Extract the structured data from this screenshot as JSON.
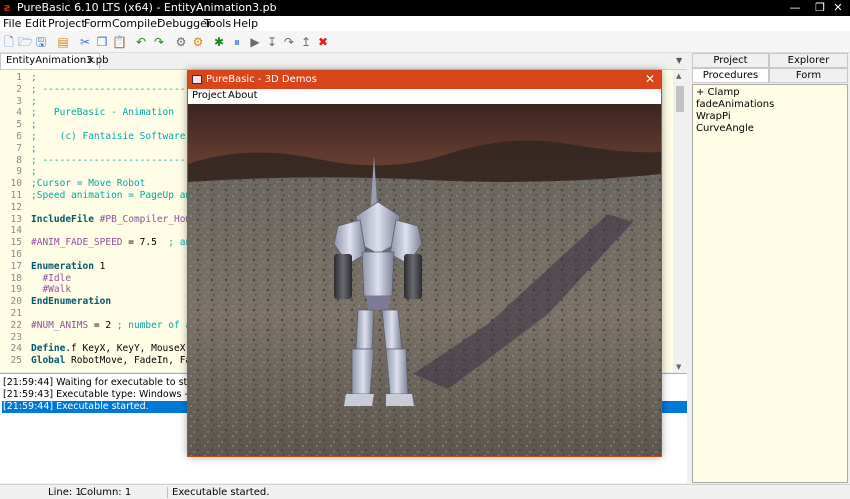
{
  "app": {
    "title": "PureBasic 6.10 LTS (x64) - EntityAnimation3.pb",
    "icon": "purebasic-logo-icon",
    "window_controls": [
      "minimize",
      "maximize",
      "close"
    ]
  },
  "menu": [
    "File",
    "Edit",
    "Project",
    "Form",
    "Compiler",
    "Debugger",
    "Tools",
    "Help"
  ],
  "toolbar": [
    {
      "icon": "new-file-icon",
      "glyph": "🗋",
      "color": "#3c78c8"
    },
    {
      "icon": "open-file-icon",
      "glyph": "🗁",
      "color": "#3c78c8"
    },
    {
      "icon": "save-icon",
      "glyph": "🖫",
      "color": "#3c78c8"
    },
    {
      "icon": "close-file-icon",
      "glyph": "▤",
      "color": "#d08a20"
    },
    {
      "icon": "cut-icon",
      "glyph": "✂",
      "color": "#3c78c8"
    },
    {
      "icon": "copy-icon",
      "glyph": "❐",
      "color": "#3c78c8"
    },
    {
      "icon": "paste-icon",
      "glyph": "📋",
      "color": "#d08a20"
    },
    {
      "icon": "undo-icon",
      "glyph": "↶",
      "color": "#1a8a1a"
    },
    {
      "icon": "redo-icon",
      "glyph": "↷",
      "color": "#1a8a1a"
    },
    {
      "icon": "compile-run-icon",
      "glyph": "⚙",
      "color": "#6a6a6a"
    },
    {
      "icon": "build-icon",
      "glyph": "⚙",
      "color": "#d08a20"
    },
    {
      "icon": "debugger-icon",
      "glyph": "✱",
      "color": "#1a8a1a"
    },
    {
      "icon": "pause-icon",
      "glyph": "⏸",
      "color": "#3c78c8"
    },
    {
      "icon": "continue-icon",
      "glyph": "▶",
      "color": "#6a6a6a"
    },
    {
      "icon": "step-icon",
      "glyph": "↧",
      "color": "#6a6a6a"
    },
    {
      "icon": "step-over-icon",
      "glyph": "↷",
      "color": "#6a6a6a"
    },
    {
      "icon": "step-out-icon",
      "glyph": "↥",
      "color": "#6a6a6a"
    },
    {
      "icon": "kill-program-icon",
      "glyph": "✖",
      "color": "#e02020"
    }
  ],
  "editor_tab": {
    "label": "EntityAnimation3.pb",
    "close": "×"
  },
  "code": [
    {
      "n": "1",
      "parts": [
        {
          "c": "cmt",
          "t": ";"
        }
      ]
    },
    {
      "n": "2",
      "parts": [
        {
          "c": "cmt",
          "t": "; ----------------------------------------------------------------------------------"
        }
      ]
    },
    {
      "n": "3",
      "parts": [
        {
          "c": "cmt",
          "t": ";"
        }
      ]
    },
    {
      "n": "4",
      "parts": [
        {
          "c": "cmt",
          "t": ";   PureBasic - Animation"
        }
      ]
    },
    {
      "n": "5",
      "parts": [
        {
          "c": "cmt",
          "t": ";"
        }
      ]
    },
    {
      "n": "6",
      "parts": [
        {
          "c": "cmt",
          "t": ";    (c) Fantaisie Software"
        }
      ]
    },
    {
      "n": "7",
      "parts": [
        {
          "c": "cmt",
          "t": ";"
        }
      ]
    },
    {
      "n": "8",
      "parts": [
        {
          "c": "cmt",
          "t": "; ----------------------------------------------------------------------------------"
        }
      ]
    },
    {
      "n": "9",
      "parts": [
        {
          "c": "cmt",
          "t": ";"
        }
      ]
    },
    {
      "n": "10",
      "parts": [
        {
          "c": "cmt",
          "t": ";Cursor = Move Robot"
        }
      ]
    },
    {
      "n": "11",
      "parts": [
        {
          "c": "cmt",
          "t": ";Speed animation = PageUp and PageDown"
        }
      ]
    },
    {
      "n": "12",
      "parts": []
    },
    {
      "n": "13",
      "parts": [
        {
          "c": "kw",
          "t": "IncludeFile"
        },
        {
          "c": "const",
          "t": " #PB_Compiler_Home"
        }
      ]
    },
    {
      "n": "14",
      "parts": []
    },
    {
      "n": "15",
      "parts": [
        {
          "c": "const",
          "t": "#ANIM_FADE_SPEED"
        },
        {
          "c": "plain",
          "t": " = 7.5  "
        },
        {
          "c": "cmt",
          "t": "; animation"
        }
      ]
    },
    {
      "n": "16",
      "parts": []
    },
    {
      "n": "17",
      "parts": [
        {
          "c": "kw",
          "t": "Enumeration"
        },
        {
          "c": "plain",
          "t": " 1"
        }
      ]
    },
    {
      "n": "18",
      "parts": [
        {
          "c": "const",
          "t": "  #Idle"
        }
      ]
    },
    {
      "n": "19",
      "parts": [
        {
          "c": "const",
          "t": "  #Walk"
        }
      ]
    },
    {
      "n": "20",
      "parts": [
        {
          "c": "kw",
          "t": "EndEnumeration"
        }
      ]
    },
    {
      "n": "21",
      "parts": []
    },
    {
      "n": "22",
      "parts": [
        {
          "c": "const",
          "t": "#NUM_ANIMS"
        },
        {
          "c": "plain",
          "t": " = 2 "
        },
        {
          "c": "cmt",
          "t": "; number of animations"
        }
      ]
    },
    {
      "n": "23",
      "parts": []
    },
    {
      "n": "24",
      "parts": [
        {
          "c": "kw",
          "t": "Define"
        },
        {
          "c": "plain",
          "t": ".f KeyX, KeyY, MouseX, MouseY"
        }
      ]
    },
    {
      "n": "25",
      "parts": [
        {
          "c": "kw",
          "t": "Global"
        },
        {
          "c": "plain",
          "t": " RobotMove, FadeIn, FadeOut"
        }
      ]
    }
  ],
  "log": [
    {
      "text": "[21:59:44] Waiting for executable to start...",
      "selected": false
    },
    {
      "text": "[21:59:43] Executable type: Windows - x64  (64bit, Unicode)",
      "selected": false
    },
    {
      "text": "[21:59:44] Executable started.",
      "selected": true
    }
  ],
  "right_panel": {
    "tabs_top": [
      "Project",
      "Explorer"
    ],
    "tabs_bottom": [
      "Procedures",
      "Form"
    ],
    "active_tab": "Procedures",
    "procedures": [
      "+ Clamp",
      "fadeAnimations",
      "WrapPi",
      "CurveAngle"
    ]
  },
  "statusbar": {
    "line": "Line: 1",
    "column": "Column: 1",
    "message": "Executable started."
  },
  "demo_window": {
    "title": "PureBasic - 3D Demos",
    "close": "✕",
    "menu": [
      "Project",
      "About"
    ],
    "scene": "robot-3d-scene"
  },
  "colors": {
    "editor_bg": "#fffde6",
    "comment": "#00a8a8",
    "keyword": "#005a6e",
    "constant": "#944fa0",
    "selection": "#0078d7",
    "demo_titlebar": "#d9441a"
  }
}
